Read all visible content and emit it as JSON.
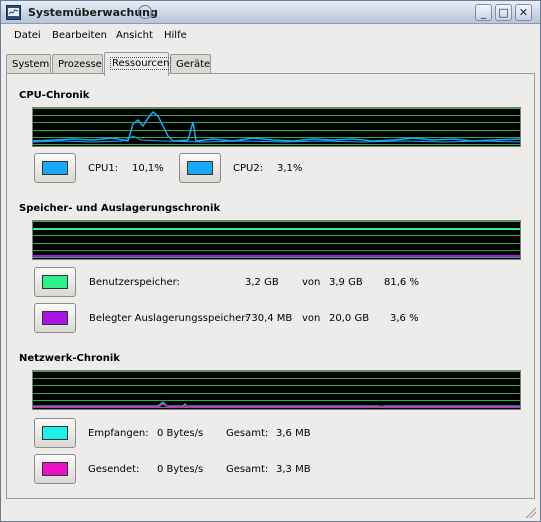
{
  "window": {
    "title": "Systemüberwachung",
    "icon": "system-monitor-icon",
    "buttons": [
      "minimize-icon",
      "maximize-icon",
      "close-icon"
    ]
  },
  "menu": {
    "items": [
      {
        "label": "Datei"
      },
      {
        "label": "Bearbeiten"
      },
      {
        "label": "Ansicht"
      },
      {
        "label": "Hilfe"
      }
    ]
  },
  "tabs": [
    {
      "label": "System"
    },
    {
      "label": "Prozesse"
    },
    {
      "label": "Ressourcen",
      "active": true
    },
    {
      "label": "Geräte"
    }
  ],
  "cpu": {
    "title": "CPU-Chronik",
    "cpu1": {
      "label": "CPU1:",
      "value": "10,1%",
      "color": "#1aa7f5"
    },
    "cpu2": {
      "label": "CPU2:",
      "value": "3,1%",
      "color": "#1aa7f5"
    }
  },
  "memory": {
    "title": "Speicher- und Auslagerungschronik",
    "user": {
      "label": "Benutzerspeicher:",
      "used": "3,2 GB",
      "of": "von",
      "total": "3,9 GB",
      "percent": "81,6 %",
      "color": "#2ef08a"
    },
    "swap": {
      "label": "Belegter Auslagerungsspeicher:",
      "used": "730,4 MB",
      "of": "von",
      "total": "20,0 GB",
      "percent": "3,6 %",
      "color": "#a913e6"
    }
  },
  "network": {
    "title": "Netzwerk-Chronik",
    "received": {
      "label": "Empfangen:",
      "rate": "0 Bytes/s",
      "total_label": "Gesamt:",
      "total": "3,6 MB",
      "color": "#1ef0ee"
    },
    "sent": {
      "label": "Gesendet:",
      "rate": "0 Bytes/s",
      "total_label": "Gesamt:",
      "total": "3,3 MB",
      "color": "#ea12c4"
    }
  },
  "theme": {
    "graph_background": "#000000",
    "grid_color": "#2fa84a"
  }
}
